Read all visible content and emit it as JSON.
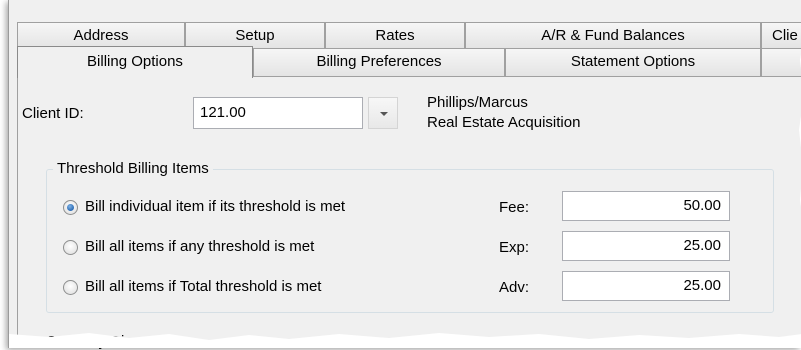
{
  "tabs": {
    "row1": [
      "Address",
      "Setup",
      "Rates",
      "A/R & Fund Balances",
      "Clie"
    ],
    "row2": [
      "Billing Options",
      "Billing Preferences",
      "Statement Options",
      ""
    ]
  },
  "client": {
    "label": "Client ID:",
    "value": "121.00",
    "name_line1": "Phillips/Marcus",
    "name_line2": "Real Estate Acquisition"
  },
  "threshold_group": {
    "legend": "Threshold Billing Items",
    "options": [
      {
        "label": "Bill individual item if its threshold is met",
        "checked": true
      },
      {
        "label": "Bill all items if any threshold is met",
        "checked": false
      },
      {
        "label": "Bill all items if Total threshold is met",
        "checked": false
      }
    ],
    "amounts": [
      {
        "label": "Fee:",
        "value": "50.00"
      },
      {
        "label": "Exp:",
        "value": "25.00"
      },
      {
        "label": "Adv:",
        "value": "25.00"
      }
    ]
  },
  "courtesy": {
    "label": "Courtesy Discount"
  }
}
